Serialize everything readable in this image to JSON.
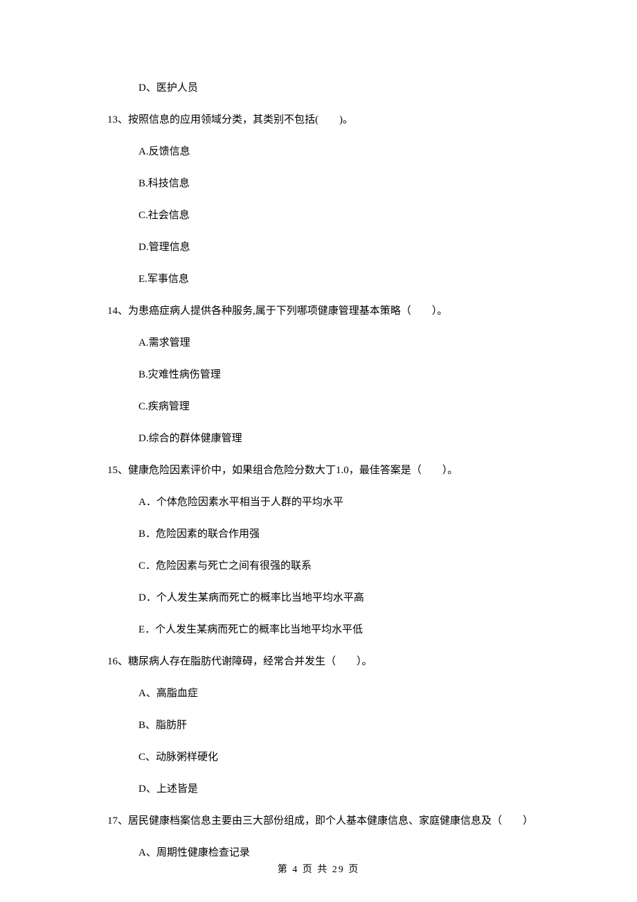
{
  "options_pre": [
    "D、医护人员"
  ],
  "questions": [
    {
      "stem": "13、按照信息的应用领域分类，其类别不包括(　　)。",
      "options": [
        "A.反馈信息",
        "B.科技信息",
        "C.社会信息",
        "D.管理信息",
        "E.军事信息"
      ]
    },
    {
      "stem": "14、为患癌症病人提供各种服务,属于下列哪项健康管理基本策略（　　）。",
      "options": [
        "A.需求管理",
        "B.灾难性病伤管理",
        "C.疾病管理",
        "D.综合的群体健康管理"
      ]
    },
    {
      "stem": "15、健康危险因素评价中，如果组合危险分数大丁1.0，最佳答案是（　　）。",
      "options": [
        "A．个体危险因素水平相当于人群的平均水平",
        "B．危险因素的联合作用强",
        "C．危险因素与死亡之间有很强的联系",
        "D．个人发生某病而死亡的概率比当地平均水平高",
        "E．个人发生某病而死亡的概率比当地平均水平低"
      ]
    },
    {
      "stem": "16、糖尿病人存在脂肪代谢障碍，经常合并发生（　　）。",
      "options": [
        "A、高脂血症",
        "B、脂肪肝",
        "C、动脉粥样硬化",
        "D、上述皆是"
      ]
    },
    {
      "stem": "17、居民健康档案信息主要由三大部份组成，即个人基本健康信息、家庭健康信息及（　　）",
      "options": [
        "A、周期性健康检查记录"
      ]
    }
  ],
  "footer": "第 4 页 共 29 页"
}
